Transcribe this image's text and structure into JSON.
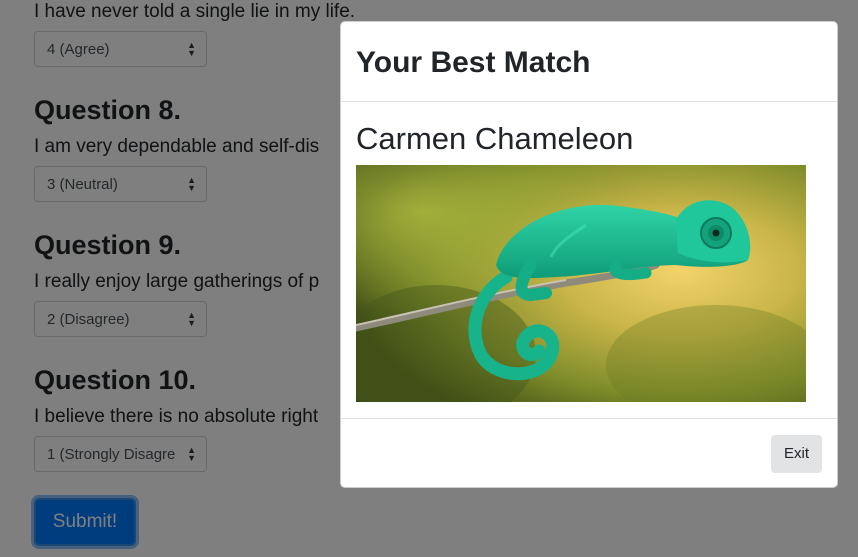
{
  "questions": [
    {
      "text": "I have never told a single lie in my life.",
      "selected": "4 (Agree)"
    },
    {
      "title": "Question 8.",
      "text": "I am very dependable and self-dis",
      "selected": "3 (Neutral)"
    },
    {
      "title": "Question 9.",
      "text": "I really enjoy large gatherings of p",
      "selected": "2 (Disagree)"
    },
    {
      "title": "Question 10.",
      "text": "I believe there is no absolute right",
      "selected": "1 (Strongly Disagre"
    }
  ],
  "submit_label": "Submit!",
  "modal": {
    "title": "Your Best Match",
    "match_name": "Carmen Chameleon",
    "exit_label": "Exit"
  },
  "colors": {
    "primary": "#007bff",
    "overlay": "rgba(0,0,0,0.5)",
    "secondary_button": "#e2e3e5"
  },
  "icons": {
    "select_caret": "up-down-caret-icon"
  }
}
